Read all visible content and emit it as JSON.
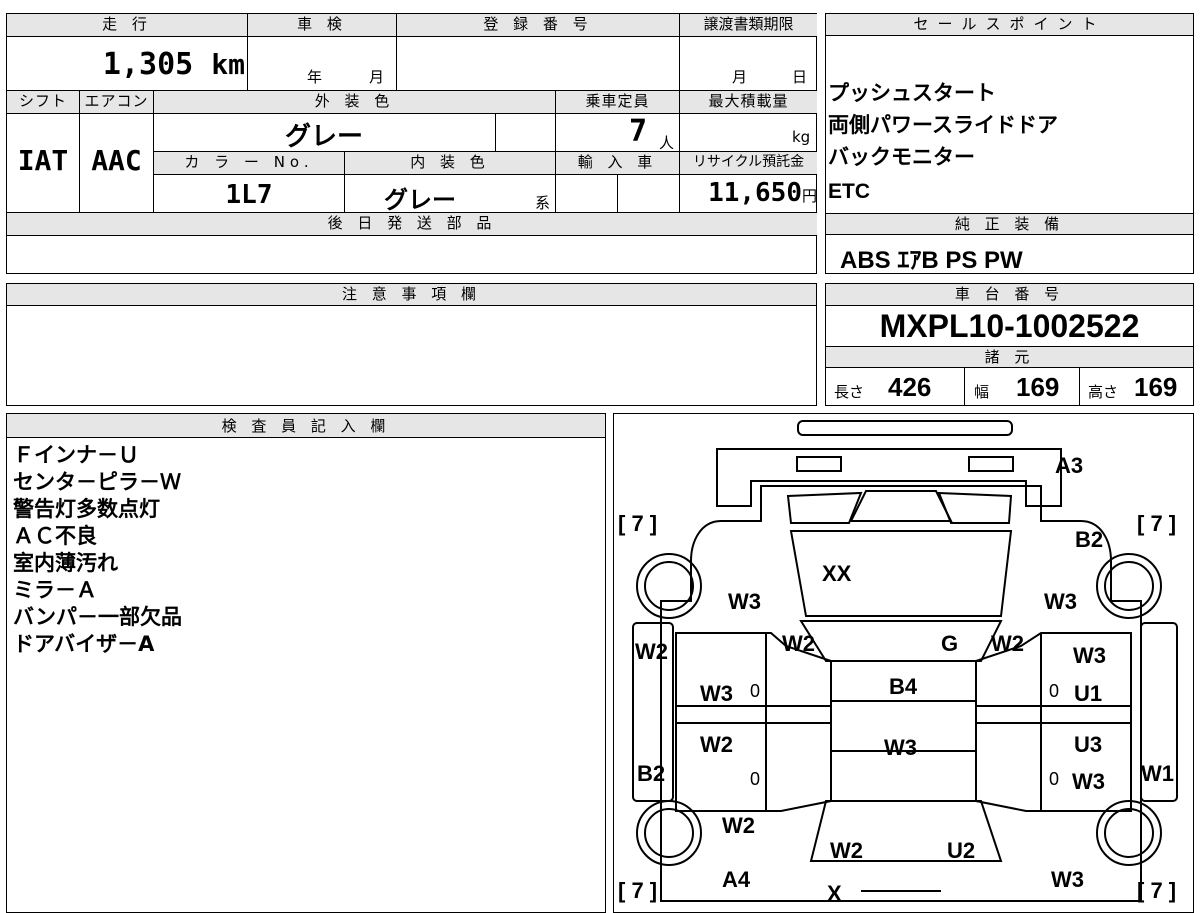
{
  "top": {
    "mileage_label": "走 行",
    "mileage_value": "1,305",
    "mileage_unit": "km",
    "inspection_label": "車 検",
    "inspection_year": "年",
    "inspection_month": "月",
    "registration_label": "登 録 番 号",
    "transfer_label": "譲渡書類期限",
    "transfer_month": "月",
    "transfer_day": "日",
    "shift_label": "シフト",
    "shift_value": "IAT",
    "ac_label": "エアコン",
    "ac_value": "AAC",
    "exterior_label": "外 装 色",
    "exterior_value": "グレー",
    "capacity_label": "乗車定員",
    "capacity_value": "7",
    "capacity_unit": "人",
    "load_label": "最大積載量",
    "load_unit": "kg",
    "color_no_label": "カ ラ ー No.",
    "color_no_value": "1L7",
    "interior_label": "内 装 色",
    "interior_value": "グレー",
    "interior_suffix": "系",
    "import_label": "輸 入 車",
    "recycle_label": "リサイクル預託金",
    "recycle_value": "11,650",
    "recycle_unit": "円",
    "later_parts_label": "後 日 発 送 部 品"
  },
  "sales": {
    "title": "セールスポイント",
    "items": [
      "プッシュスタート",
      "両側パワースライドドア",
      "バックモニター",
      "ETC"
    ]
  },
  "equipment": {
    "title": "純 正 装 備",
    "value": "ABS ｴｱB PS PW"
  },
  "notes": {
    "title": "注 意 事 項 欄"
  },
  "chassis": {
    "title": "車 台 番 号",
    "value": "MXPL10-1002522",
    "spec_title": "諸 元",
    "length_label": "長さ",
    "length_value": "426",
    "width_label": "幅",
    "width_value": "169",
    "height_label": "高さ",
    "height_value": "169"
  },
  "inspector": {
    "title": "検 査 員 記 入 欄",
    "items": [
      "Ｆインナ－Ｕ",
      "センタ－ピラ－Ｗ",
      "警告灯多数点灯",
      "ＡＣ不良",
      "室内薄汚れ",
      "ミラ－Ａ",
      "バンパ－一部欠品",
      "ドアバイザ－A"
    ]
  },
  "diagram": {
    "marks": {
      "a3": "A3",
      "b2_right": "B2",
      "xx": "XX",
      "w3_hood_left": "W3",
      "w3_hood_right": "W3",
      "w2_wsl": "W2",
      "g": "G",
      "w2_wsr": "W2",
      "w2_left": "W2",
      "w3_left_front": "W3",
      "zero_left_front": "0",
      "b4": "B4",
      "w3_right_top": "W3",
      "zero_right_front": "0",
      "u1": "U1",
      "w2_left_rear": "W2",
      "w3_roof": "W3",
      "u3": "U3",
      "b2_left": "B2",
      "zero_left_rear": "0",
      "zero_right_rear": "0",
      "w3_right_rear": "W3",
      "w1": "W1",
      "w2_bottom_left": "W2",
      "w2_back": "W2",
      "u2": "U2",
      "a4": "A4",
      "w3_bottom_right": "W3",
      "x": "X",
      "tire_fl": "[ 7 ]",
      "tire_fr": "[ 7 ]",
      "tire_rl": "[ 7 ]",
      "tire_rr": "[ 7 ]"
    }
  }
}
